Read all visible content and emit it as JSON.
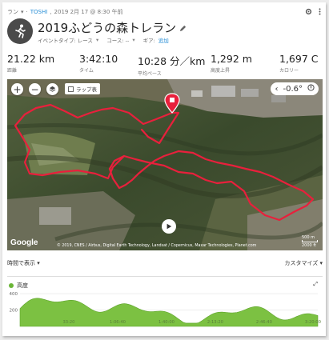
{
  "header": {
    "activity_type": "ラン",
    "user": "TOSHI",
    "date": "2019 2月 17 @ 8:30 午前"
  },
  "activity": {
    "title": "2019ふどうの森トレラン",
    "event_type": "イベントタイプ: レース",
    "course": "コース: --",
    "gear_label": "ギア:",
    "gear_link": "追加"
  },
  "stats": [
    {
      "value": "21.22",
      "unit": "km",
      "label": "距離"
    },
    {
      "value": "3:42:10",
      "unit": "",
      "label": "タイム"
    },
    {
      "value": "10:28",
      "unit": "分／km",
      "label": "平均ペース"
    },
    {
      "value": "1,292",
      "unit": "m",
      "label": "高度上昇"
    },
    {
      "value": "1,697",
      "unit": "C",
      "label": "カロリー"
    }
  ],
  "map": {
    "zoom_in": "+",
    "zoom_out": "−",
    "lap_label": "ラップ表",
    "temperature": "-0.6°",
    "logo": "Google",
    "attribution": "© 2019, CNES / Airbus, Digital Earth Technology, Landsat / Copernicus, Maxar Technologies, Planet.com",
    "scale_m": "500 m",
    "scale_ft": "2000 ft",
    "route_color": "#e8203c",
    "route": [
      [
        168,
        63
      ],
      [
        176,
        72
      ],
      [
        190,
        80
      ],
      [
        200,
        64
      ],
      [
        214,
        42
      ],
      [
        206,
        42
      ],
      [
        186,
        50
      ],
      [
        170,
        56
      ],
      [
        152,
        42
      ],
      [
        132,
        36
      ],
      [
        118,
        38
      ],
      [
        104,
        42
      ],
      [
        88,
        48
      ],
      [
        72,
        40
      ],
      [
        54,
        32
      ],
      [
        36,
        36
      ],
      [
        22,
        44
      ],
      [
        10,
        58
      ],
      [
        20,
        74
      ],
      [
        28,
        88
      ],
      [
        22,
        104
      ],
      [
        28,
        118
      ],
      [
        44,
        120
      ],
      [
        66,
        116
      ],
      [
        88,
        114
      ],
      [
        110,
        118
      ],
      [
        126,
        124
      ],
      [
        132,
        110
      ],
      [
        146,
        96
      ],
      [
        160,
        100
      ],
      [
        176,
        104
      ],
      [
        196,
        108
      ],
      [
        214,
        116
      ],
      [
        232,
        118
      ],
      [
        248,
        126
      ],
      [
        262,
        130
      ],
      [
        280,
        128
      ],
      [
        296,
        140
      ],
      [
        304,
        156
      ],
      [
        322,
        170
      ],
      [
        340,
        176
      ],
      [
        358,
        166
      ],
      [
        374,
        158
      ],
      [
        382,
        150
      ],
      [
        370,
        140
      ],
      [
        352,
        132
      ],
      [
        332,
        122
      ],
      [
        316,
        116
      ],
      [
        298,
        112
      ],
      [
        282,
        108
      ],
      [
        262,
        104
      ],
      [
        248,
        100
      ],
      [
        232,
        92
      ],
      [
        214,
        90
      ],
      [
        196,
        96
      ],
      [
        184,
        102
      ],
      [
        176,
        108
      ],
      [
        164,
        118
      ],
      [
        156,
        126
      ],
      [
        148,
        132
      ],
      [
        140,
        136
      ],
      [
        132,
        124
      ],
      [
        128,
        112
      ],
      [
        134,
        102
      ],
      [
        146,
        96
      ]
    ]
  },
  "chart_controls": {
    "view_by": "時間で表示",
    "customize": "カスタマイズ"
  },
  "chart_data": {
    "type": "area",
    "title": "高度",
    "x_ticks": [
      "33:20",
      "1:06:40",
      "1:40:00",
      "2:13:20",
      "2:46:40",
      "3:20:00"
    ],
    "y_ticks": [
      400,
      200
    ],
    "ylim": [
      0,
      450
    ],
    "x": [
      0,
      5,
      10,
      15,
      20,
      25,
      30,
      35,
      40,
      45,
      50,
      55,
      60,
      65,
      70,
      75,
      80,
      85,
      90,
      95,
      100,
      105,
      110,
      115,
      120,
      125,
      130,
      135,
      140,
      145,
      150,
      155,
      160,
      165,
      170,
      175,
      180,
      185,
      190,
      195,
      200,
      205,
      210,
      215,
      220,
      225,
      230,
      235,
      240,
      245,
      250,
      255,
      260,
      265,
      270,
      275,
      280,
      285,
      290,
      295,
      300,
      305,
      310,
      315,
      320,
      325,
      330,
      335,
      340,
      345,
      350,
      355,
      360,
      365,
      370,
      375,
      380,
      385,
      390,
      395,
      400,
      405,
      410,
      415,
      420,
      425,
      430,
      435,
      440,
      445,
      450,
      455,
      460,
      465,
      470,
      475,
      480,
      485,
      490,
      495,
      500,
      505,
      510,
      515,
      520,
      525,
      530,
      535,
      540,
      545,
      550,
      555,
      560,
      565,
      570,
      575,
      580,
      585,
      590,
      595,
      600,
      605,
      610,
      615,
      620,
      625,
      630,
      635,
      640,
      645,
      650,
      655,
      660,
      665,
      670,
      675,
      680,
      685,
      690,
      695,
      700,
      705,
      710,
      715,
      720,
      725,
      730,
      735,
      740,
      745,
      750,
      755,
      760,
      765,
      770,
      775,
      780,
      785,
      790,
      795,
      800,
      805,
      810,
      815,
      820,
      825,
      830,
      835,
      840,
      845,
      850,
      855,
      860,
      865,
      870,
      875,
      880,
      885,
      890,
      895,
      900,
      905,
      910,
      915,
      920,
      925,
      930,
      935,
      940,
      945,
      950,
      955,
      960,
      965,
      970,
      975,
      980,
      985,
      990,
      995,
      1000,
      1005,
      1010,
      1015,
      1020,
      1025,
      1030,
      1035,
      1040,
      1045,
      1050,
      1055,
      1060,
      1065,
      1070,
      1075,
      1080,
      1085,
      1090,
      1095,
      1100,
      1105,
      1110,
      1115,
      1120,
      1125,
      1130,
      1135,
      1140,
      1145,
      1150,
      1155,
      1160,
      1165,
      1170,
      1175,
      1180,
      1185,
      1190,
      1195,
      1200,
      1205,
      1210,
      1215,
      1220,
      1225,
      1230,
      1235,
      1240,
      1245,
      1250,
      1255,
      1260,
      1265,
      1270,
      1275,
      1280,
      1285,
      1290,
      1295,
      1300,
      1305,
      1310,
      1315,
      1320,
      1325,
      1330,
      1335,
      1340,
      1345,
      1350,
      1355,
      1360,
      1365,
      1370,
      1375,
      1380,
      1385,
      1390,
      1395,
      1400,
      1405,
      1410,
      1415,
      1420,
      1425,
      1430,
      1435,
      1440,
      1445,
      1450,
      1455,
      1460,
      1465,
      1470,
      1475,
      1480,
      1485,
      1490,
      1495,
      1500,
      1505,
      1510,
      1515,
      1520,
      1525,
      1530,
      1535,
      1540,
      1545,
      1550,
      1555,
      1560,
      1565,
      1570,
      1575,
      1580,
      1585,
      1590,
      1595,
      1600,
      1605,
      1610,
      1615,
      1620,
      1625,
      1630,
      1635,
      1640,
      1645,
      1650,
      1655,
      1660,
      1665,
      1670,
      1675,
      1680,
      1685,
      1690,
      1695,
      1700,
      1705,
      1710,
      1715,
      1720,
      1725,
      1730,
      1735,
      1740,
      1745,
      1750,
      1755,
      1760,
      1765,
      1770,
      1775,
      1780,
      1785,
      1790,
      1795,
      1800,
      1805,
      1810,
      1815,
      1820,
      1825,
      1830,
      1835,
      1840,
      1845,
      1850,
      1855,
      1860,
      1865,
      1870,
      1875,
      1880,
      1885,
      1890,
      1895,
      1900,
      1905,
      1910,
      1915,
      1920,
      1925,
      1930,
      1935,
      1940,
      1945,
      1950,
      1955,
      1960,
      1965,
      1970,
      1975,
      1980,
      1985,
      1990,
      1995,
      2000,
      2005,
      2010,
      2015,
      2020,
      2025,
      2030,
      2035,
      2040,
      2045,
      2050,
      2055,
      2060,
      2065,
      2070,
      2075,
      2080,
      2085,
      2090,
      2095,
      2100,
      2105,
      2110,
      2115,
      2120,
      2125,
      2130,
      2135,
      2140,
      2145,
      2150,
      2155,
      2160,
      2165,
      2170,
      2175,
      2180,
      2185,
      2190,
      2195,
      2200,
      2205,
      2210,
      2215,
      2220
    ],
    "xlim": [
      0,
      13330
    ]
  }
}
